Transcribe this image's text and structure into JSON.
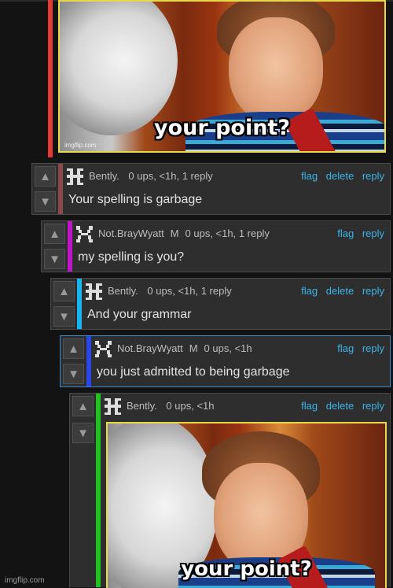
{
  "meme": {
    "caption": "your point?",
    "watermark": "imgflip.com"
  },
  "comments": [
    {
      "user": "Bently.",
      "mod": "",
      "stats": "0 ups, <1h, 1 reply",
      "text": "Your spelling is garbage",
      "actions": [
        "flag",
        "delete",
        "reply"
      ],
      "color": "#8b4a4a"
    },
    {
      "user": "Not.BrayWyatt",
      "mod": "M",
      "stats": "0 ups, <1h, 1 reply",
      "text": "my spelling is you?",
      "actions": [
        "flag",
        "reply"
      ],
      "color": "#c014c8"
    },
    {
      "user": "Bently.",
      "mod": "",
      "stats": "0 ups, <1h, 1 reply",
      "text": "And your grammar",
      "actions": [
        "flag",
        "delete",
        "reply"
      ],
      "color": "#1ab4f0"
    },
    {
      "user": "Not.BrayWyatt",
      "mod": "M",
      "stats": "0 ups, <1h",
      "text": "you just admitted to being garbage",
      "actions": [
        "flag",
        "reply"
      ],
      "color": "#2a46e6"
    },
    {
      "user": "Bently.",
      "mod": "",
      "stats": "0 ups, <1h",
      "text": "",
      "actions": [
        "flag",
        "delete",
        "reply"
      ],
      "color": "#21c321"
    }
  ],
  "vote": {
    "up_icon": "arrow-up-icon",
    "down_icon": "arrow-down-icon"
  },
  "footer": {
    "watermark": "imgflip.com"
  }
}
